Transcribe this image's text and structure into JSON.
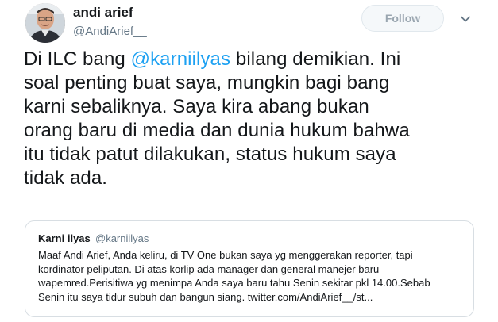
{
  "author": {
    "name": "andi arief",
    "handle": "@AndiArief__"
  },
  "follow_label": "Follow",
  "tweet": {
    "lines": [
      {
        "before": "Di ILC bang ",
        "mention": "@karniilyas",
        "after": " bilang demikian. Ini"
      },
      "soal penting buat saya, mungkin bagi bang",
      "karni sebaliknya. Saya kira abang bukan",
      "orang baru di media dan dunia hukum bahwa",
      "itu tidak patut dilakukan, status hukum saya",
      "tidak ada."
    ]
  },
  "quoted": {
    "name": "Karni ilyas",
    "handle": "@karniilyas",
    "lines": [
      "Maaf Andi Arief, Anda keliru, di TV One bukan saya yg menggerakan reporter, tapi",
      "kordinator peliputan. Di atas korlip ada manager dan general manejer baru",
      "wapemred.Perisitiwa yg menimpa Anda saya baru tahu Senin sekitar pkl 14.00.Sebab",
      "Senin itu saya tidur subuh dan bangun siang. twitter.com/AndiArief__/st..."
    ]
  },
  "colors": {
    "link": "#1da1f2",
    "secondary_text": "#657786",
    "border": "#e1e8ed"
  },
  "icons": {
    "caret": "chevron-down-icon",
    "avatar": "profile-photo"
  }
}
